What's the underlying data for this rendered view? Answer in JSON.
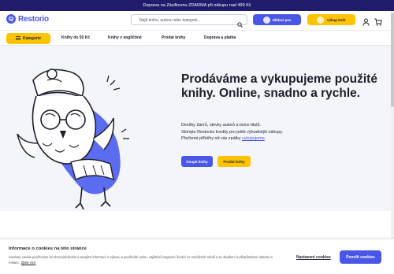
{
  "announcement": "Doprava na Zásilkovnu ZDARMA při nákupu nad 499 Kč",
  "header": {
    "logo_text": "Restorio",
    "search_placeholder": "Najít knihu, autora nebo kategorii...",
    "hledani_label": "Hlídací pes",
    "vykup_label": "Výkup knih"
  },
  "nav": {
    "categories_label": "Kategorie",
    "links": [
      "Knihy do 50 Kč",
      "Knihy v angličtině",
      "Prodat knihy",
      "Doprava a platba"
    ]
  },
  "hero": {
    "title": "Prodáváme a vykupujeme použité knihy. Online, snadno a rychle.",
    "line1": "Desítky žánrů, stovky autorů a tisíce titulů.",
    "line2": "Sbírejte Restocks kredity pro ještě výhodnější nákupy.",
    "line3_prefix": "Přečtené příběhy od vás zpátky ",
    "line3_link": "vykupujeme",
    "line3_suffix": ".",
    "buy_label": "Koupit knihy",
    "sell_label": "Prodat knihy"
  },
  "cookie": {
    "title": "Informace o cookies na této stránce",
    "text": "Soubory cookie používáme ke shromažďování a analýze informací o výkonu a používání webu, zajištění fungování funkcí ze sociálních médií a ke zlepšení a přizpůsobení obsahu a reklam.",
    "more_link": "Zjistit více",
    "settings_label": "Nastavení cookies",
    "accept_label": "Povolit cookies"
  },
  "colors": {
    "primary": "#4a57e6",
    "accent": "#ffc400",
    "topbar": "#1e1c6b",
    "hero_bg": "#f3f5fb"
  }
}
